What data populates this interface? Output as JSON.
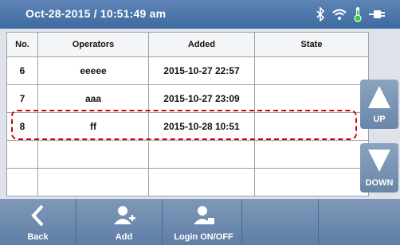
{
  "status_bar": {
    "datetime": "Oct-28-2015 / 10:51:49 am",
    "icons": [
      "bluetooth-icon",
      "wifi-icon",
      "thermometer-icon",
      "plug-icon"
    ]
  },
  "table": {
    "headers": {
      "no": "No.",
      "operators": "Operators",
      "added": "Added",
      "state": "State"
    },
    "rows": [
      {
        "no": "6",
        "operator": "eeeee",
        "added": "2015-10-27 22:57",
        "state": ""
      },
      {
        "no": "7",
        "operator": "aaa",
        "added": "2015-10-27 23:09",
        "state": ""
      },
      {
        "no": "8",
        "operator": "ff",
        "added": "2015-10-28 10:51",
        "state": ""
      }
    ]
  },
  "side_buttons": {
    "up": "UP",
    "down": "DOWN"
  },
  "bottom_bar": {
    "back": "Back",
    "add": "Add",
    "login": "Login ON/OFF"
  },
  "colors": {
    "highlight": "#d40000",
    "status_bar": "#4b74a8"
  }
}
